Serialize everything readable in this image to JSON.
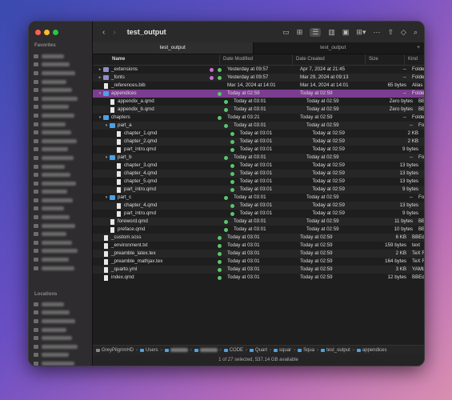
{
  "window": {
    "title": "test_output"
  },
  "sidebar": {
    "heading": "Favorites",
    "heading2": "Locations"
  },
  "toolbar": {
    "back": "‹",
    "forward": "›"
  },
  "tabs": [
    "test_output",
    "test_output"
  ],
  "columns": {
    "name": "Name",
    "modified": "Date Modified",
    "created": "Date Created",
    "size": "Size",
    "kind": "Kind"
  },
  "rows": [
    {
      "depth": 0,
      "tri": "▸",
      "icon": "folder-grey",
      "name": "_extensions",
      "mod": "Yesterday at 09:57",
      "cre": "Apr 7, 2024 at 21:45",
      "size": "--",
      "kind": "Folder",
      "tags": "pink-green"
    },
    {
      "depth": 0,
      "tri": "▸",
      "icon": "folder-grey",
      "name": "_fonts",
      "mod": "Yesterday at 09:57",
      "cre": "Mar 29, 2024 at 09:13",
      "size": "--",
      "kind": "Folder",
      "tags": "pink-green"
    },
    {
      "depth": 0,
      "tri": "",
      "icon": "file",
      "name": "_references.bib",
      "mod": "Mar 14, 2024 at 14:01",
      "cre": "Mar 14, 2024 at 14:01",
      "size": "65 bytes",
      "kind": "Alias",
      "tags": ""
    },
    {
      "depth": 0,
      "tri": "▾",
      "icon": "folder",
      "name": "appendices",
      "mod": "Today at 02:59",
      "cre": "Today at 02:59",
      "size": "--",
      "kind": "Folder",
      "tags": "green",
      "sel": true
    },
    {
      "depth": 1,
      "tri": "",
      "icon": "file",
      "name": "appendix_a.qmd",
      "mod": "Today at 03:01",
      "cre": "Today at 02:59",
      "size": "Zero bytes",
      "kind": "BBEdit...",
      "tags": "green"
    },
    {
      "depth": 1,
      "tri": "",
      "icon": "file",
      "name": "appendix_b.qmd",
      "mod": "Today at 03:01",
      "cre": "Today at 02:59",
      "size": "Zero bytes",
      "kind": "BBEdit...",
      "tags": "green"
    },
    {
      "depth": 0,
      "tri": "▾",
      "icon": "folder",
      "name": "chapters",
      "mod": "Today at 03:21",
      "cre": "Today at 02:59",
      "size": "--",
      "kind": "Folder",
      "tags": "green"
    },
    {
      "depth": 1,
      "tri": "▾",
      "icon": "folder",
      "name": "part_a",
      "mod": "Today at 03:01",
      "cre": "Today at 02:59",
      "size": "--",
      "kind": "Folder",
      "tags": "green"
    },
    {
      "depth": 2,
      "tri": "",
      "icon": "file",
      "name": "chapter_1.qmd",
      "mod": "Today at 03:01",
      "cre": "Today at 02:59",
      "size": "2 KB",
      "kind": "BBEdit...",
      "tags": "green"
    },
    {
      "depth": 2,
      "tri": "",
      "icon": "file",
      "name": "chapter_2.qmd",
      "mod": "Today at 03:01",
      "cre": "Today at 02:59",
      "size": "2 KB",
      "kind": "BBEdit...",
      "tags": "green"
    },
    {
      "depth": 2,
      "tri": "",
      "icon": "file",
      "name": "part_intro.qmd",
      "mod": "Today at 03:01",
      "cre": "Today at 02:59",
      "size": "9 bytes",
      "kind": "BBEdit...",
      "tags": "green"
    },
    {
      "depth": 1,
      "tri": "▾",
      "icon": "folder",
      "name": "part_b",
      "mod": "Today at 03:01",
      "cre": "Today at 02:59",
      "size": "--",
      "kind": "Folder",
      "tags": "green"
    },
    {
      "depth": 2,
      "tri": "",
      "icon": "file",
      "name": "chapter_3.qmd",
      "mod": "Today at 03:01",
      "cre": "Today at 02:59",
      "size": "13 bytes",
      "kind": "BBEdit...",
      "tags": "green"
    },
    {
      "depth": 2,
      "tri": "",
      "icon": "file",
      "name": "chapter_4.qmd",
      "mod": "Today at 03:01",
      "cre": "Today at 02:59",
      "size": "13 bytes",
      "kind": "BBEdit...",
      "tags": "green"
    },
    {
      "depth": 2,
      "tri": "",
      "icon": "file",
      "name": "chapter_5.qmd",
      "mod": "Today at 03:01",
      "cre": "Today at 02:59",
      "size": "13 bytes",
      "kind": "BBEdit...",
      "tags": "green"
    },
    {
      "depth": 2,
      "tri": "",
      "icon": "file",
      "name": "part_intro.qmd",
      "mod": "Today at 03:01",
      "cre": "Today at 02:59",
      "size": "9 bytes",
      "kind": "BBEdit...",
      "tags": "green"
    },
    {
      "depth": 1,
      "tri": "▾",
      "icon": "folder",
      "name": "part_c",
      "mod": "Today at 03:01",
      "cre": "Today at 02:59",
      "size": "--",
      "kind": "Folder",
      "tags": "green"
    },
    {
      "depth": 2,
      "tri": "",
      "icon": "file",
      "name": "chapter_4.qmd",
      "mod": "Today at 03:01",
      "cre": "Today at 02:59",
      "size": "13 bytes",
      "kind": "BBEdit...",
      "tags": "green"
    },
    {
      "depth": 2,
      "tri": "",
      "icon": "file",
      "name": "part_intro.qmd",
      "mod": "Today at 03:01",
      "cre": "Today at 02:59",
      "size": "9 bytes",
      "kind": "BBEdit...",
      "tags": "green"
    },
    {
      "depth": 1,
      "tri": "",
      "icon": "file",
      "name": "foreword.qmd",
      "mod": "Today at 03:01",
      "cre": "Today at 02:59",
      "size": "11 bytes",
      "kind": "BBEdit...",
      "tags": "green"
    },
    {
      "depth": 1,
      "tri": "",
      "icon": "file",
      "name": "preface.qmd",
      "mod": "Today at 03:01",
      "cre": "Today at 02:59",
      "size": "10 bytes",
      "kind": "BBEdit...",
      "tags": "green"
    },
    {
      "depth": 0,
      "tri": "",
      "icon": "file",
      "name": "_custom.scss",
      "mod": "Today at 03:01",
      "cre": "Today at 02:59",
      "size": "6 KB",
      "kind": "BBEdit...",
      "tags": "green"
    },
    {
      "depth": 0,
      "tri": "",
      "icon": "file",
      "name": "_environment.txt",
      "mod": "Today at 03:01",
      "cre": "Today at 02:59",
      "size": "159 bytes",
      "kind": "text",
      "tags": "green"
    },
    {
      "depth": 0,
      "tri": "",
      "icon": "file",
      "name": "_preamble_latex.tex",
      "mod": "Today at 03:01",
      "cre": "Today at 02:59",
      "size": "2 KB",
      "kind": "TeX File",
      "tags": "green"
    },
    {
      "depth": 0,
      "tri": "",
      "icon": "file",
      "name": "_preamble_mathjax.tex",
      "mod": "Today at 03:01",
      "cre": "Today at 02:59",
      "size": "164 bytes",
      "kind": "TeX File",
      "tags": "green"
    },
    {
      "depth": 0,
      "tri": "",
      "icon": "file",
      "name": "_quarto.yml",
      "mod": "Today at 03:01",
      "cre": "Today at 02:59",
      "size": "3 KB",
      "kind": "YAML",
      "tags": "green"
    },
    {
      "depth": 0,
      "tri": "",
      "icon": "file",
      "name": "index.qmd",
      "mod": "Today at 03:01",
      "cre": "Today at 02:59",
      "size": "12 bytes",
      "kind": "BBEdit...",
      "tags": "green"
    }
  ],
  "pathbar": [
    "GreyPilgrimHD",
    "Users",
    "",
    "",
    "CODE",
    "Quart",
    "squar",
    "Squa",
    "test_output",
    "appendices"
  ],
  "status": "1 of 27 selected, 537.14 GB available",
  "colors": {
    "selection": "#7b3d8f",
    "folder": "#4aa3e6",
    "tag_green": "#5bc56c",
    "tag_pink": "#c86fd0"
  }
}
